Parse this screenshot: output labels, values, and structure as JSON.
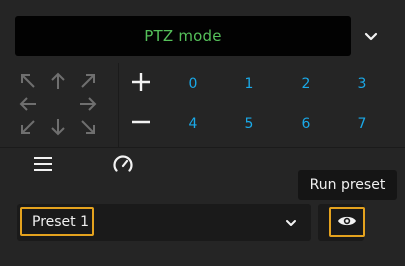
{
  "mode_selector": {
    "value": "PTZ mode",
    "value_color": "#55c05a",
    "chevron_icon": "chevron-down-icon"
  },
  "joystick": {
    "icons": [
      "arrow-up-left-icon",
      "arrow-up-icon",
      "arrow-up-right-icon",
      "arrow-left-icon",
      "arrow-right-icon",
      "arrow-down-left-icon",
      "arrow-down-icon",
      "arrow-down-right-icon"
    ],
    "disabled_color": "#6f6f6f"
  },
  "zoom": {
    "in_icon": "plus-icon",
    "out_icon": "minus-icon"
  },
  "preset_numbers": [
    "0",
    "1",
    "2",
    "3",
    "4",
    "5",
    "6",
    "7"
  ],
  "preset_number_color": "#1aa9e8",
  "bottom_toolbar": {
    "menu_icon": "hamburger-menu-icon",
    "speed_icon": "speedometer-icon"
  },
  "tooltip": {
    "text": "Run preset"
  },
  "preset_select": {
    "value": "Preset 1",
    "chevron_icon": "chevron-down-icon"
  },
  "run_preset_button": {
    "icon": "eye-icon",
    "highlight_color": "#e4a21e"
  }
}
